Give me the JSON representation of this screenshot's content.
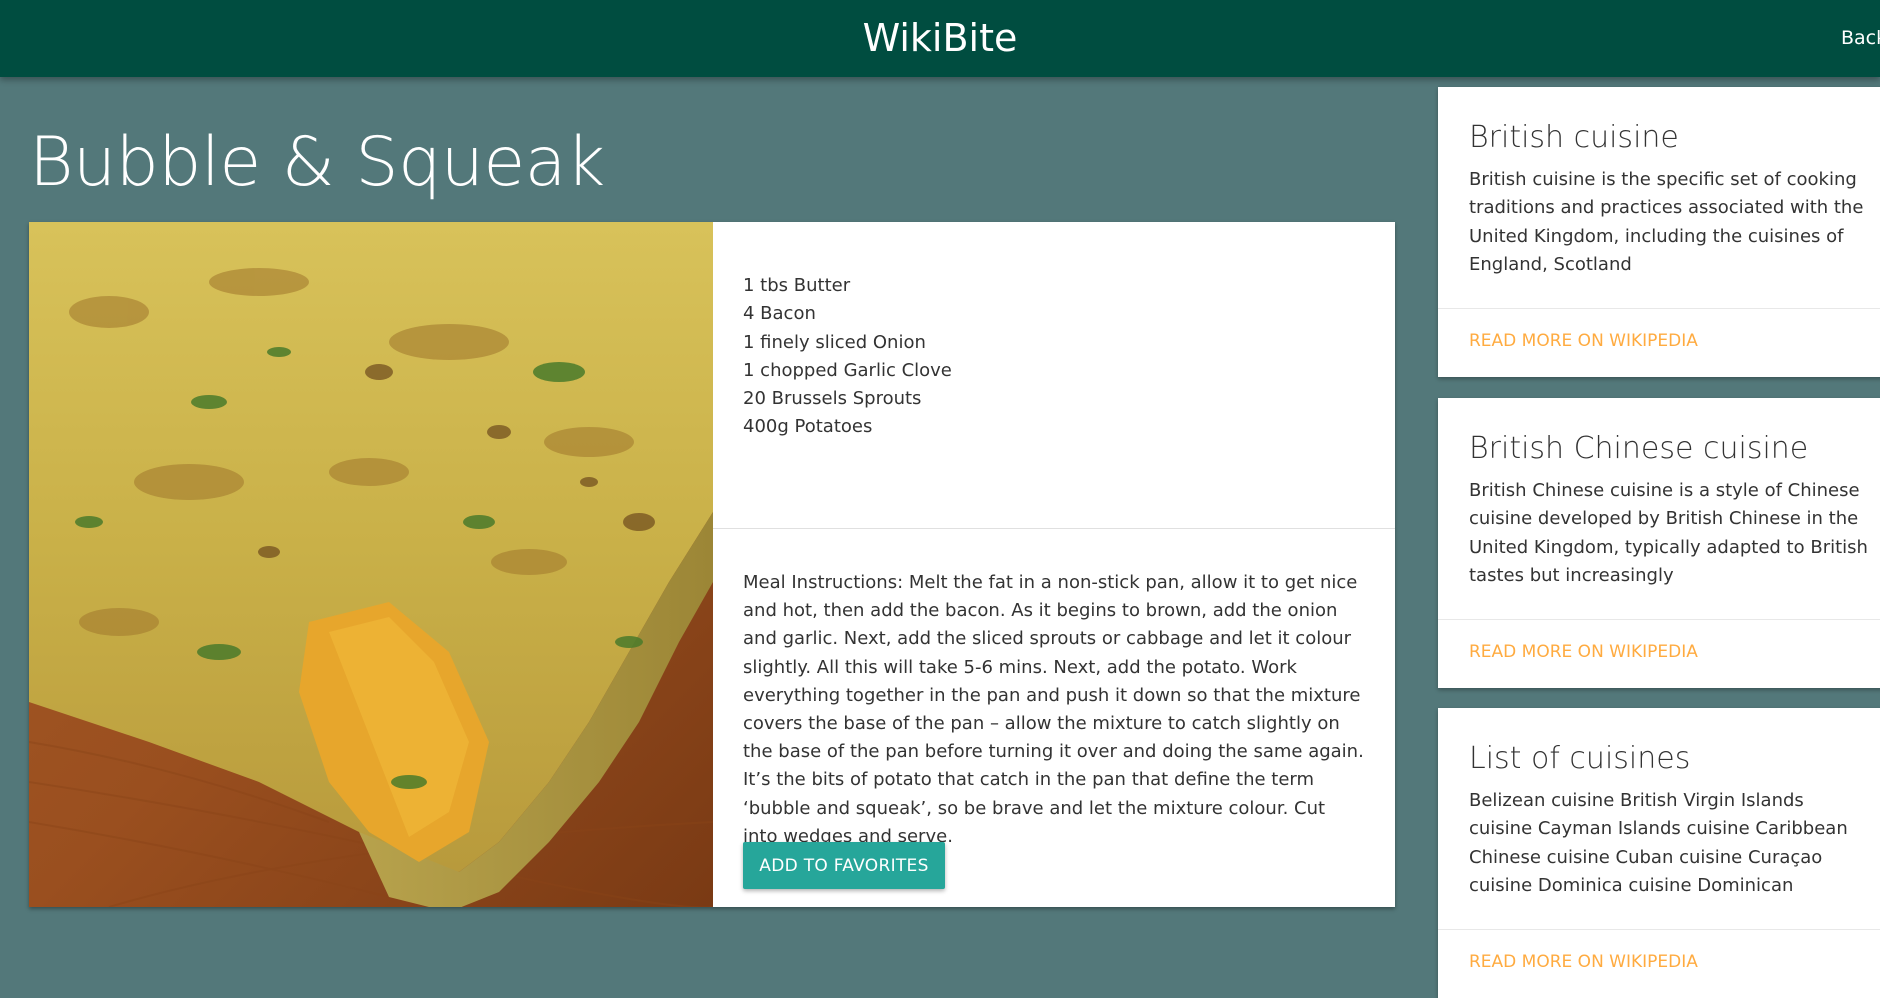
{
  "header": {
    "brand": "WikiBite",
    "back_label": "Back"
  },
  "recipe": {
    "title": "Bubble & Squeak",
    "ingredients": [
      "1 tbs Butter",
      "4 Bacon",
      "1 finely sliced Onion",
      "1 chopped Garlic Clove",
      "20 Brussels Sprouts",
      "400g Potatoes"
    ],
    "instructions": "Meal Instructions: Melt the fat in a non-stick pan, allow it to get nice and hot, then add the bacon. As it begins to brown, add the onion and garlic. Next, add the sliced sprouts or cabbage and let it colour slightly. All this will take 5-6 mins. Next, add the potato. Work everything together in the pan and push it down so that the mixture covers the base of the pan – allow the mixture to catch slightly on the base of the pan before turning it over and doing the same again. It’s the bits of potato that catch in the pan that define the term ‘bubble and squeak’, so be brave and let the mixture colour. Cut into wedges and serve.",
    "favorite_label": "ADD TO FAVORITES"
  },
  "related": [
    {
      "title": "British cuisine",
      "summary": "British cuisine is the specific set of cooking traditions and practices associated with the United Kingdom, including the cuisines of England, Scotland",
      "link_label": "READ MORE ON WIKIPEDIA"
    },
    {
      "title": "British Chinese cuisine",
      "summary": "British Chinese cuisine is a style of Chinese cuisine developed by British Chinese in the United Kingdom, typically adapted to British tastes but increasingly",
      "link_label": "READ MORE ON WIKIPEDIA"
    },
    {
      "title": "List of cuisines",
      "summary": "Belizean cuisine British Virgin Islands cuisine Cayman Islands cuisine Caribbean Chinese cuisine Cuban cuisine Curaçao cuisine Dominica cuisine Dominican",
      "link_label": "READ MORE ON WIKIPEDIA"
    }
  ],
  "colors": {
    "header": "#004d40",
    "background": "#53787a",
    "button": "#26a69a",
    "link": "#ffab40"
  }
}
